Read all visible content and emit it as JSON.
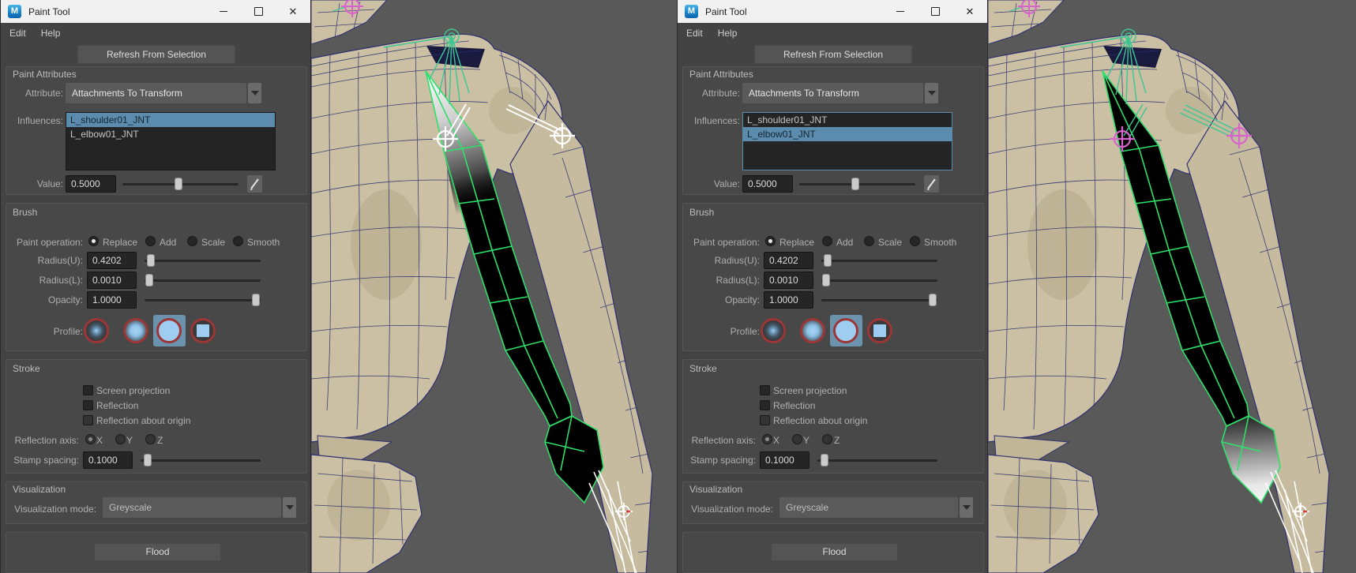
{
  "window": {
    "title": "Paint Tool",
    "menu": [
      "Edit",
      "Help"
    ],
    "refresh_button": "Refresh From Selection",
    "flood_button": "Flood"
  },
  "paint_attributes": {
    "title": "Paint Attributes",
    "attribute_label": "Attribute:",
    "attribute_value": "Attachments To Transform",
    "influences_label": "Influences:",
    "influences": [
      "L_shoulder01_JNT",
      "L_elbow01_JNT"
    ],
    "value_label": "Value:",
    "value": "0.5000"
  },
  "brush": {
    "title": "Brush",
    "paint_operation_label": "Paint operation:",
    "operations": [
      "Replace",
      "Add",
      "Scale",
      "Smooth"
    ],
    "selected_operation": "Replace",
    "radius_u_label": "Radius(U):",
    "radius_u": "0.4202",
    "radius_l_label": "Radius(L):",
    "radius_l": "0.0010",
    "opacity_label": "Opacity:",
    "opacity": "1.0000",
    "profile_label": "Profile:",
    "profiles": [
      "gaussian",
      "soft",
      "solid-circle",
      "square"
    ],
    "selected_profile": "solid-circle"
  },
  "stroke": {
    "title": "Stroke",
    "checkboxes": [
      {
        "label": "Screen projection",
        "checked": false,
        "enabled": true
      },
      {
        "label": "Reflection",
        "checked": false,
        "enabled": true
      },
      {
        "label": "Reflection about origin",
        "checked": false,
        "enabled": false
      }
    ],
    "reflection_axis_label": "Reflection axis:",
    "axes": [
      "X",
      "Y",
      "Z"
    ],
    "selected_axis": "X",
    "axes_enabled": false,
    "stamp_spacing_label": "Stamp spacing:",
    "stamp_spacing": "0.1000"
  },
  "visualization": {
    "title": "Visualization",
    "mode_label": "Visualization mode:",
    "mode_value": "Greyscale"
  },
  "panels": {
    "left": {
      "selected_influence": "L_shoulder01_JNT"
    },
    "right": {
      "selected_influence": "L_elbow01_JNT"
    }
  },
  "colors": {
    "titlebar": "#f1f1f1",
    "panel_bg": "#434343",
    "selection_blue": "#5b8bad",
    "maya_icon_blue": "#1785cd",
    "profile_ring_red": "#9d3636",
    "profile_fill_blue": "#9fcdf2",
    "viewport_bg": "#595959",
    "mesh_tan": "#cbc0a3",
    "wireframe_navy": "#2e3070",
    "selected_faces_black": "#000000",
    "selection_wire_green": "#2ee06a",
    "skeleton_teal": "#3cc792",
    "locator_white": "#ffffff",
    "locator_magenta": "#d863cc"
  }
}
